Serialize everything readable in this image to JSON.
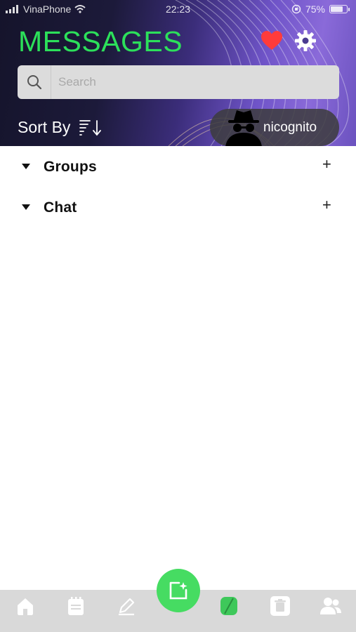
{
  "status_bar": {
    "carrier": "VinaPhone",
    "time": "22:23",
    "battery": "75%",
    "battery_level": 0.75
  },
  "header": {
    "title": "MESSAGES",
    "icons": [
      "heart-icon",
      "gear-icon"
    ]
  },
  "search": {
    "placeholder": "Search",
    "value": ""
  },
  "sort": {
    "label": "Sort By"
  },
  "user": {
    "name": "nicognito",
    "avatar": "incognito-avatar"
  },
  "sections": [
    {
      "label": "Groups",
      "action": "+"
    },
    {
      "label": "Chat",
      "action": "+"
    }
  ],
  "tab_bar": {
    "tabs": [
      "home-icon",
      "notes-icon",
      "edit-icon",
      "compose-icon",
      "chat-tab-icon",
      "trash-icon",
      "contacts-icon"
    ],
    "active": "chat-tab-icon"
  },
  "colors": {
    "accent_green": "#2ce05a",
    "heart_red": "#ff3b3b",
    "tab_bar_bg": "#d9d9d9"
  }
}
